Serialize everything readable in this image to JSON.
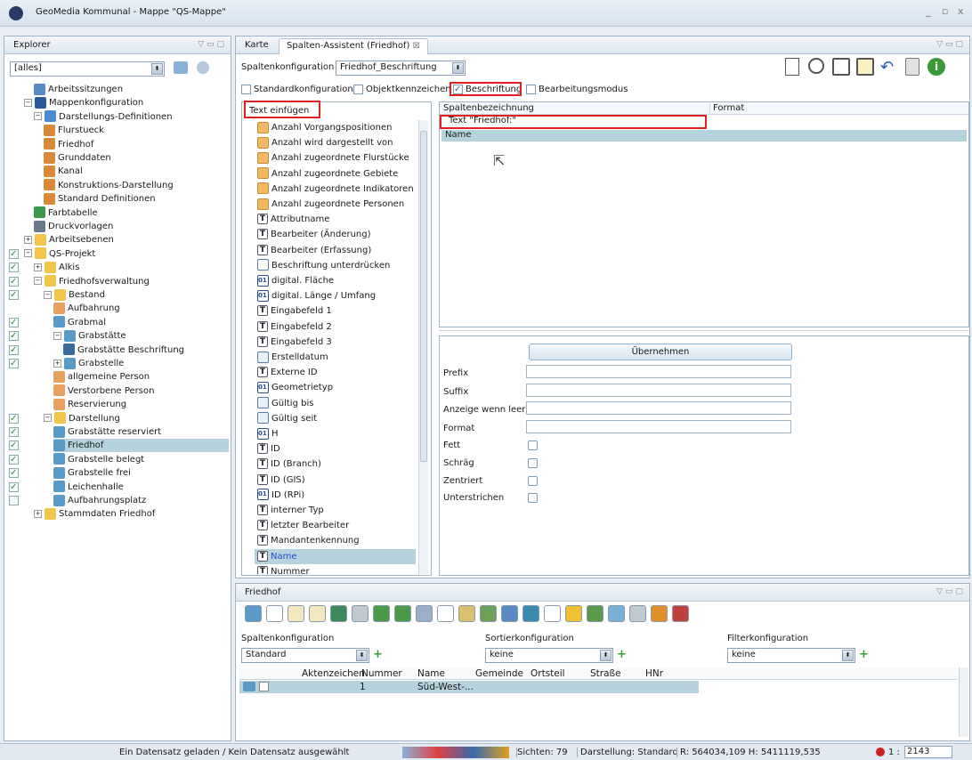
{
  "window": {
    "title": "GeoMedia Kommunal - Mappe \"QS-Mappe\"",
    "controls": [
      "_",
      "▫",
      "x"
    ]
  },
  "explorer": {
    "tab": "Explorer",
    "filter": "[alles]",
    "tree": [
      {
        "label": "Arbeitssitzungen",
        "indent": 1,
        "color": "#5a8ac6",
        "check": null
      },
      {
        "label": "Mappenkonfiguration",
        "indent": 0,
        "color": "#2a5a9a",
        "expand": "−",
        "check": null
      },
      {
        "label": "Darstellungs-Definitionen",
        "indent": 1,
        "color": "#4a8ad0",
        "expand": "−",
        "check": null
      },
      {
        "label": "Flurstueck",
        "indent": 2,
        "color": "#d88a3a",
        "check": null
      },
      {
        "label": "Friedhof",
        "indent": 2,
        "color": "#d88a3a",
        "check": null
      },
      {
        "label": "Grunddaten",
        "indent": 2,
        "color": "#d88a3a",
        "check": null
      },
      {
        "label": "Kanal",
        "indent": 2,
        "color": "#d88a3a",
        "check": null
      },
      {
        "label": "Konstruktions-Darstellung",
        "indent": 2,
        "color": "#d88a3a",
        "check": null
      },
      {
        "label": "Standard Definitionen",
        "indent": 2,
        "color": "#d88a3a",
        "check": null
      },
      {
        "label": "Farbtabelle",
        "indent": 1,
        "color": "#3a9a4a",
        "check": null
      },
      {
        "label": "Druckvorlagen",
        "indent": 1,
        "color": "#6a7a8a",
        "check": null
      },
      {
        "label": "Arbeitsebenen",
        "indent": 0,
        "color": "#f1c64a",
        "expand": "+",
        "check": null
      },
      {
        "label": "QS-Projekt",
        "indent": 0,
        "color": "#f1c64a",
        "expand": "−",
        "check": "✓"
      },
      {
        "label": "Alkis",
        "indent": 1,
        "color": "#f1c64a",
        "expand": "+",
        "check": "✓"
      },
      {
        "label": "Friedhofsverwaltung",
        "indent": 1,
        "color": "#f1c64a",
        "expand": "−",
        "check": "✓"
      },
      {
        "label": "Bestand",
        "indent": 2,
        "color": "#f1c64a",
        "expand": "−",
        "check": "✓"
      },
      {
        "label": "Aufbahrung",
        "indent": 3,
        "color": "#e8a060",
        "check": null
      },
      {
        "label": "Grabmal",
        "indent": 3,
        "color": "#5a9ac6",
        "check": "✓"
      },
      {
        "label": "Grabstätte",
        "indent": 3,
        "color": "#5a9ac6",
        "expand": "−",
        "check": "✓"
      },
      {
        "label": "Grabstätte Beschriftung",
        "indent": 4,
        "color": "#3a6a9a",
        "check": "✓"
      },
      {
        "label": "Grabstelle",
        "indent": 3,
        "color": "#5a9ac6",
        "expand": "+",
        "check": "✓"
      },
      {
        "label": "allgemeine Person",
        "indent": 3,
        "color": "#e8a060",
        "check": null
      },
      {
        "label": "Verstorbene Person",
        "indent": 3,
        "color": "#e8a060",
        "check": null
      },
      {
        "label": "Reservierung",
        "indent": 3,
        "color": "#e8a060",
        "check": null
      },
      {
        "label": "Darstellung",
        "indent": 2,
        "color": "#f1c64a",
        "expand": "−",
        "check": "✓"
      },
      {
        "label": "Grabstätte reserviert",
        "indent": 3,
        "color": "#5a9ac6",
        "check": "✓"
      },
      {
        "label": "Friedhof",
        "indent": 3,
        "color": "#5a9ac6",
        "check": "✓",
        "selected": true
      },
      {
        "label": "Grabstelle belegt",
        "indent": 3,
        "color": "#5a9ac6",
        "check": "✓"
      },
      {
        "label": "Grabstelle frei",
        "indent": 3,
        "color": "#5a9ac6",
        "check": "✓"
      },
      {
        "label": "Leichenhalle",
        "indent": 3,
        "color": "#5a9ac6",
        "check": "✓"
      },
      {
        "label": "Aufbahrungsplatz",
        "indent": 3,
        "color": "#5a9ac6",
        "check": "□"
      },
      {
        "label": "Stammdaten Friedhof",
        "indent": 1,
        "color": "#f1c64a",
        "expand": "+",
        "check": null
      }
    ]
  },
  "editor": {
    "tabs": [
      {
        "label": "Karte"
      },
      {
        "label": "Spalten-Assistent (Friedhof)"
      }
    ],
    "close_tab_symbol": "⊠",
    "config_label": "Spaltenkonfiguration",
    "config_value": "Friedhof_Beschriftung",
    "checks": [
      {
        "label": "Standardkonfiguration",
        "checked": false
      },
      {
        "label": "Objektkennzeichen",
        "checked": false
      },
      {
        "label": "Beschriftung",
        "checked": true
      },
      {
        "label": "Bearbeitungsmodus",
        "checked": false
      }
    ],
    "insert_text_label": "Text einfügen",
    "attr_list": [
      {
        "label": "Anzahl Vorgangspositionen",
        "icon": "calc"
      },
      {
        "label": "Anzahl wird dargestellt von",
        "icon": "calc"
      },
      {
        "label": "Anzahl zugeordnete Flurstücke",
        "icon": "calc"
      },
      {
        "label": "Anzahl zugeordnete Gebiete",
        "icon": "calc"
      },
      {
        "label": "Anzahl zugeordnete Indikatoren",
        "icon": "calc"
      },
      {
        "label": "Anzahl zugeordnete Personen",
        "icon": "calc"
      },
      {
        "label": "Attributname",
        "icon": "T"
      },
      {
        "label": "Bearbeiter (Änderung)",
        "icon": "T"
      },
      {
        "label": "Bearbeiter (Erfassung)",
        "icon": "T"
      },
      {
        "label": "Beschriftung unterdrücken",
        "icon": "bool"
      },
      {
        "label": "digital. Fläche",
        "icon": "01"
      },
      {
        "label": "digital. Länge / Umfang",
        "icon": "01"
      },
      {
        "label": "Eingabefeld 1",
        "icon": "T"
      },
      {
        "label": "Eingabefeld 2",
        "icon": "T"
      },
      {
        "label": "Eingabefeld 3",
        "icon": "T"
      },
      {
        "label": "Erstelldatum",
        "icon": "date"
      },
      {
        "label": "Externe ID",
        "icon": "T"
      },
      {
        "label": "Geometrietyp",
        "icon": "01"
      },
      {
        "label": "Gültig bis",
        "icon": "date"
      },
      {
        "label": "Gültig seit",
        "icon": "date"
      },
      {
        "label": "H",
        "icon": "01"
      },
      {
        "label": "ID",
        "icon": "T"
      },
      {
        "label": "ID (Branch)",
        "icon": "T"
      },
      {
        "label": "ID (GIS)",
        "icon": "T"
      },
      {
        "label": "ID (RPi)",
        "icon": "01"
      },
      {
        "label": "interner Typ",
        "icon": "T"
      },
      {
        "label": "letzter Bearbeiter",
        "icon": "T"
      },
      {
        "label": "Mandantenkennung",
        "icon": "T"
      },
      {
        "label": "Name",
        "icon": "T",
        "selected": true
      },
      {
        "label": "Nummer",
        "icon": "T"
      }
    ],
    "columns_header": {
      "name": "Spaltenbezeichnung",
      "format": "Format"
    },
    "columns": [
      {
        "name": "Text \"Friedhof:\"",
        "format": ""
      },
      {
        "name": "Name",
        "format": "",
        "selected": true
      }
    ],
    "apply_button": "Übernehmen",
    "props": {
      "prefix": "Prefix",
      "suffix": "Suffix",
      "empty": "Anzeige wenn leer",
      "format": "Format",
      "bold": "Fett",
      "italic": "Schräg",
      "center": "Zentriert",
      "underline": "Unterstrichen"
    }
  },
  "bottom": {
    "tab": "Friedhof",
    "labels": {
      "spalten": "Spaltenkonfiguration",
      "sort": "Sortierkonfiguration",
      "filter": "Filterkonfiguration"
    },
    "values": {
      "spalten": "Standard",
      "sort": "keine",
      "filter": "keine"
    },
    "table_headers": [
      "Aktenzeichen",
      "Nummer",
      "Name",
      "Gemeinde",
      "Ortsteil",
      "Straße",
      "HNr"
    ],
    "rows": [
      {
        "nummer": "1",
        "name": "Süd-West-..."
      }
    ]
  },
  "status": {
    "message": "Ein Datensatz geladen / Kein Datensatz ausgewählt",
    "sichten": "Sichten: 79",
    "darstellung": "Darstellung: Standard",
    "coords": "R: 564034,109  H: 5411119,535",
    "scale_prefix": "1 :",
    "scale": "2143"
  },
  "colors": {
    "highlight_red": "#e02020",
    "selection": "#b6d2dc",
    "frame": "#9fb3c8"
  }
}
